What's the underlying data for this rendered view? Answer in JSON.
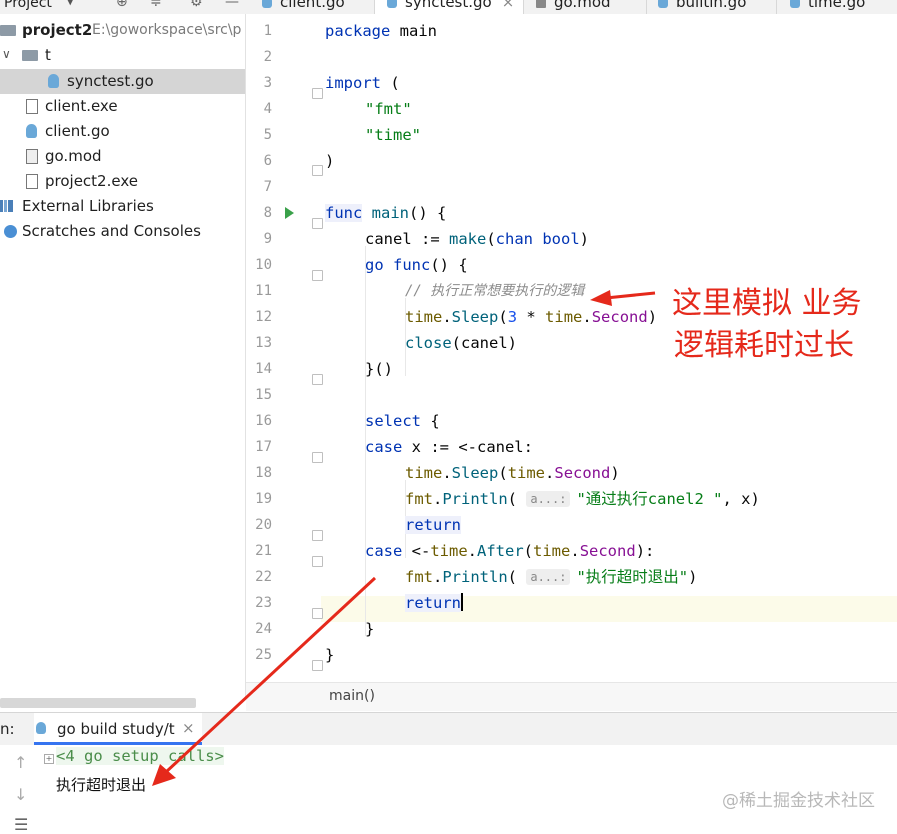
{
  "project_panel": {
    "title": "Project"
  },
  "tabs": [
    {
      "label": "client.go"
    },
    {
      "label": "synctest.go",
      "active": true
    },
    {
      "label": "go.mod"
    },
    {
      "label": "builtin.go"
    },
    {
      "label": "time.go"
    }
  ],
  "tree": {
    "root_name": "project2",
    "root_path": "E:\\goworkspace\\src\\p",
    "folder_t": "t",
    "items": [
      "synctest.go",
      "client.exe",
      "client.go",
      "go.mod",
      "project2.exe"
    ],
    "external_libraries": "External Libraries",
    "scratches": "Scratches and Consoles"
  },
  "editor": {
    "line_numbers": [
      "1",
      "2",
      "3",
      "4",
      "5",
      "6",
      "7",
      "8",
      "9",
      "10",
      "11",
      "12",
      "13",
      "14",
      "15",
      "16",
      "17",
      "18",
      "19",
      "20",
      "21",
      "22",
      "23",
      "24",
      "25"
    ],
    "breadcrumb": "main()",
    "hint_label": "a...:"
  },
  "code": {
    "l1_kw": "package",
    "l1_name": "main",
    "l3_kw": "import",
    "l3_rest": " (",
    "l4": "\"fmt\"",
    "l5": "\"time\"",
    "l6": ")",
    "l8_kw": "func",
    "l8_fn": "main",
    "l8_rest": "() {",
    "l9_a": "canel := ",
    "l9_fn": "make",
    "l9_b": "(",
    "l9_kw": "chan bool",
    "l9_c": ")",
    "l10_kw1": "go",
    "l10_kw2": "func",
    "l10_rest": "() {",
    "l11": "// 执行正常想要执行的逻辑",
    "l12_pkg": "time",
    "l12_dot": ".",
    "l12_fn": "Sleep",
    "l12_open": "(",
    "l12_num": "3",
    "l12_op": " * ",
    "l12_pkg2": "time",
    "l12_dot2": ".",
    "l12_cst": "Second",
    "l12_close": ")",
    "l13_fn": "close",
    "l13_rest": "(canel)",
    "l14": "}()",
    "l16_kw": "select",
    "l16_rest": " {",
    "l17_kw": "case",
    "l17_rest": " x := <-canel:",
    "l18_pkg": "time",
    "l18_dot": ".",
    "l18_fn": "Sleep",
    "l18_open": "(",
    "l18_pkg2": "time",
    "l18_dot2": ".",
    "l18_cst": "Second",
    "l18_close": ")",
    "l19_pkg": "fmt",
    "l19_dot": ".",
    "l19_fn": "Println",
    "l19_open": "( ",
    "l19_str": "\"通过执行canel2 \"",
    "l19_rest": ", x)",
    "l20_kw": "return",
    "l21_kw": "case",
    "l21_a": " <-",
    "l21_pkg": "time",
    "l21_dot": ".",
    "l21_fn": "After",
    "l21_open": "(",
    "l21_pkg2": "time",
    "l21_dot2": ".",
    "l21_cst": "Second",
    "l21_close": "):",
    "l22_pkg": "fmt",
    "l22_dot": ".",
    "l22_fn": "Println",
    "l22_open": "( ",
    "l22_str": "\"执行超时退出\"",
    "l22_close": ")",
    "l23_kw": "return",
    "l24": "}",
    "l25": "}"
  },
  "run_panel": {
    "label": "n:",
    "tab": "go build study/t",
    "close": "×",
    "setup_line": "<4 go setup calls>",
    "output": "执行超时退出"
  },
  "annotation": {
    "line1": "这里模拟 业务",
    "line2": "逻辑耗时过长"
  },
  "watermark": "@稀土掘金技术社区",
  "colors": {
    "keyword": "#0033b3",
    "string": "#067d17",
    "annotation": "#e5291b",
    "active_tab": "#3574f0"
  }
}
